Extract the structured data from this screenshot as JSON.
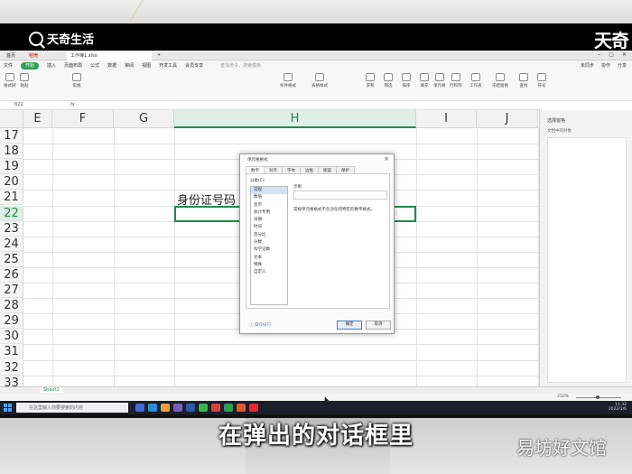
{
  "brand": {
    "logo": "天奇生活",
    "corner": "天奇"
  },
  "tabs": {
    "home": "首页",
    "shell": "稻壳",
    "doc": "工作簿1.xlsx",
    "plus": "+"
  },
  "menu": [
    "文件",
    "开始",
    "插入",
    "页面布局",
    "公式",
    "数据",
    "审阅",
    "视图",
    "开发工具",
    "会员专享"
  ],
  "menu_search": "查找命令、搜索模板",
  "menu_right": [
    "未同步",
    "协作",
    "分享"
  ],
  "ribbon": [
    "格式刷",
    "粘贴",
    "常规",
    "条件格式",
    "表格样式",
    "求和",
    "筛选",
    "排序",
    "填充",
    "单元格",
    "行和列",
    "工作表",
    "冻结窗格",
    "查找",
    "符号"
  ],
  "formula": {
    "namebox": "B22",
    "fx": "fx"
  },
  "columns": [
    "E",
    "F",
    "G",
    "H",
    "I",
    "J"
  ],
  "selected_column": "H",
  "rows": [
    "17",
    "18",
    "19",
    "20",
    "21",
    "22",
    "23",
    "24",
    "25",
    "26",
    "27",
    "28",
    "29",
    "30",
    "31",
    "32",
    "33"
  ],
  "selected_row": "22",
  "cell_text": "身份证号码",
  "dialog": {
    "title": "单元格格式",
    "close": "×",
    "tabs": [
      "数字",
      "对齐",
      "字体",
      "边框",
      "图案",
      "保护"
    ],
    "category_label": "分类(C):",
    "categories": [
      "常规",
      "数值",
      "货币",
      "会计专用",
      "日期",
      "时间",
      "百分比",
      "分数",
      "科学记数",
      "文本",
      "特殊",
      "自定义"
    ],
    "selected_category": "常规",
    "sample_label": "示例",
    "description": "常规单元格格式不包含任何特定的数字格式。",
    "tip": "操作技巧",
    "ok": "确定",
    "cancel": "取消"
  },
  "right_pane": {
    "title": "选择窗格",
    "subtitle": "文档中的对象",
    "footer": "全部显示  全部隐藏"
  },
  "sheet_tab": "Sheet1",
  "zoom": "250%",
  "taskbar": {
    "search": "在这里输入你要搜索的内容",
    "time": "11:32",
    "date": "2022/1/6"
  },
  "subtitle": "在弹出的对话框里",
  "watermark": "易坊好文馆",
  "colors": {
    "accent": "#1e8a4b",
    "start_btn": "#2e9f54"
  }
}
